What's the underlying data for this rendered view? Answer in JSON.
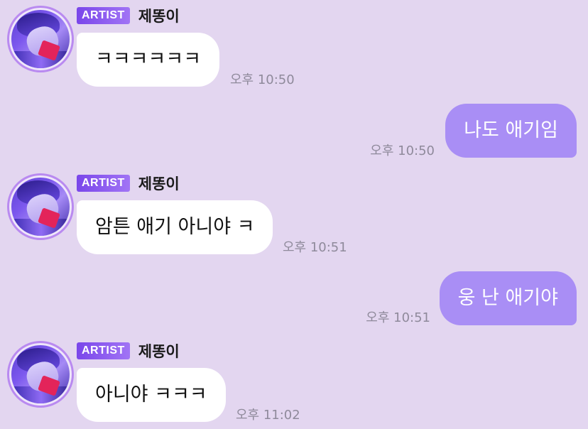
{
  "chat": {
    "messages": [
      {
        "direction": "in",
        "badge": "ARTIST",
        "sender": "제똥이",
        "text": "ㅋㅋㅋㅋㅋㅋ",
        "time": "오후 10:50"
      },
      {
        "direction": "out",
        "text": "나도 애기임",
        "time": "오후 10:50"
      },
      {
        "direction": "in",
        "badge": "ARTIST",
        "sender": "제똥이",
        "text": "암튼 애기 아니야 ㅋ",
        "time": "오후 10:51"
      },
      {
        "direction": "out",
        "text": "웅 난 애기야",
        "time": "오후 10:51"
      },
      {
        "direction": "in",
        "badge": "ARTIST",
        "sender": "제똥이",
        "text": "아니야 ㅋㅋㅋ",
        "time": "오후 11:02"
      }
    ]
  },
  "colors": {
    "background": "#e3d6f0",
    "incoming_bubble": "#ffffff",
    "outgoing_bubble": "#a98ef5",
    "badge": "#8a5cf0"
  }
}
